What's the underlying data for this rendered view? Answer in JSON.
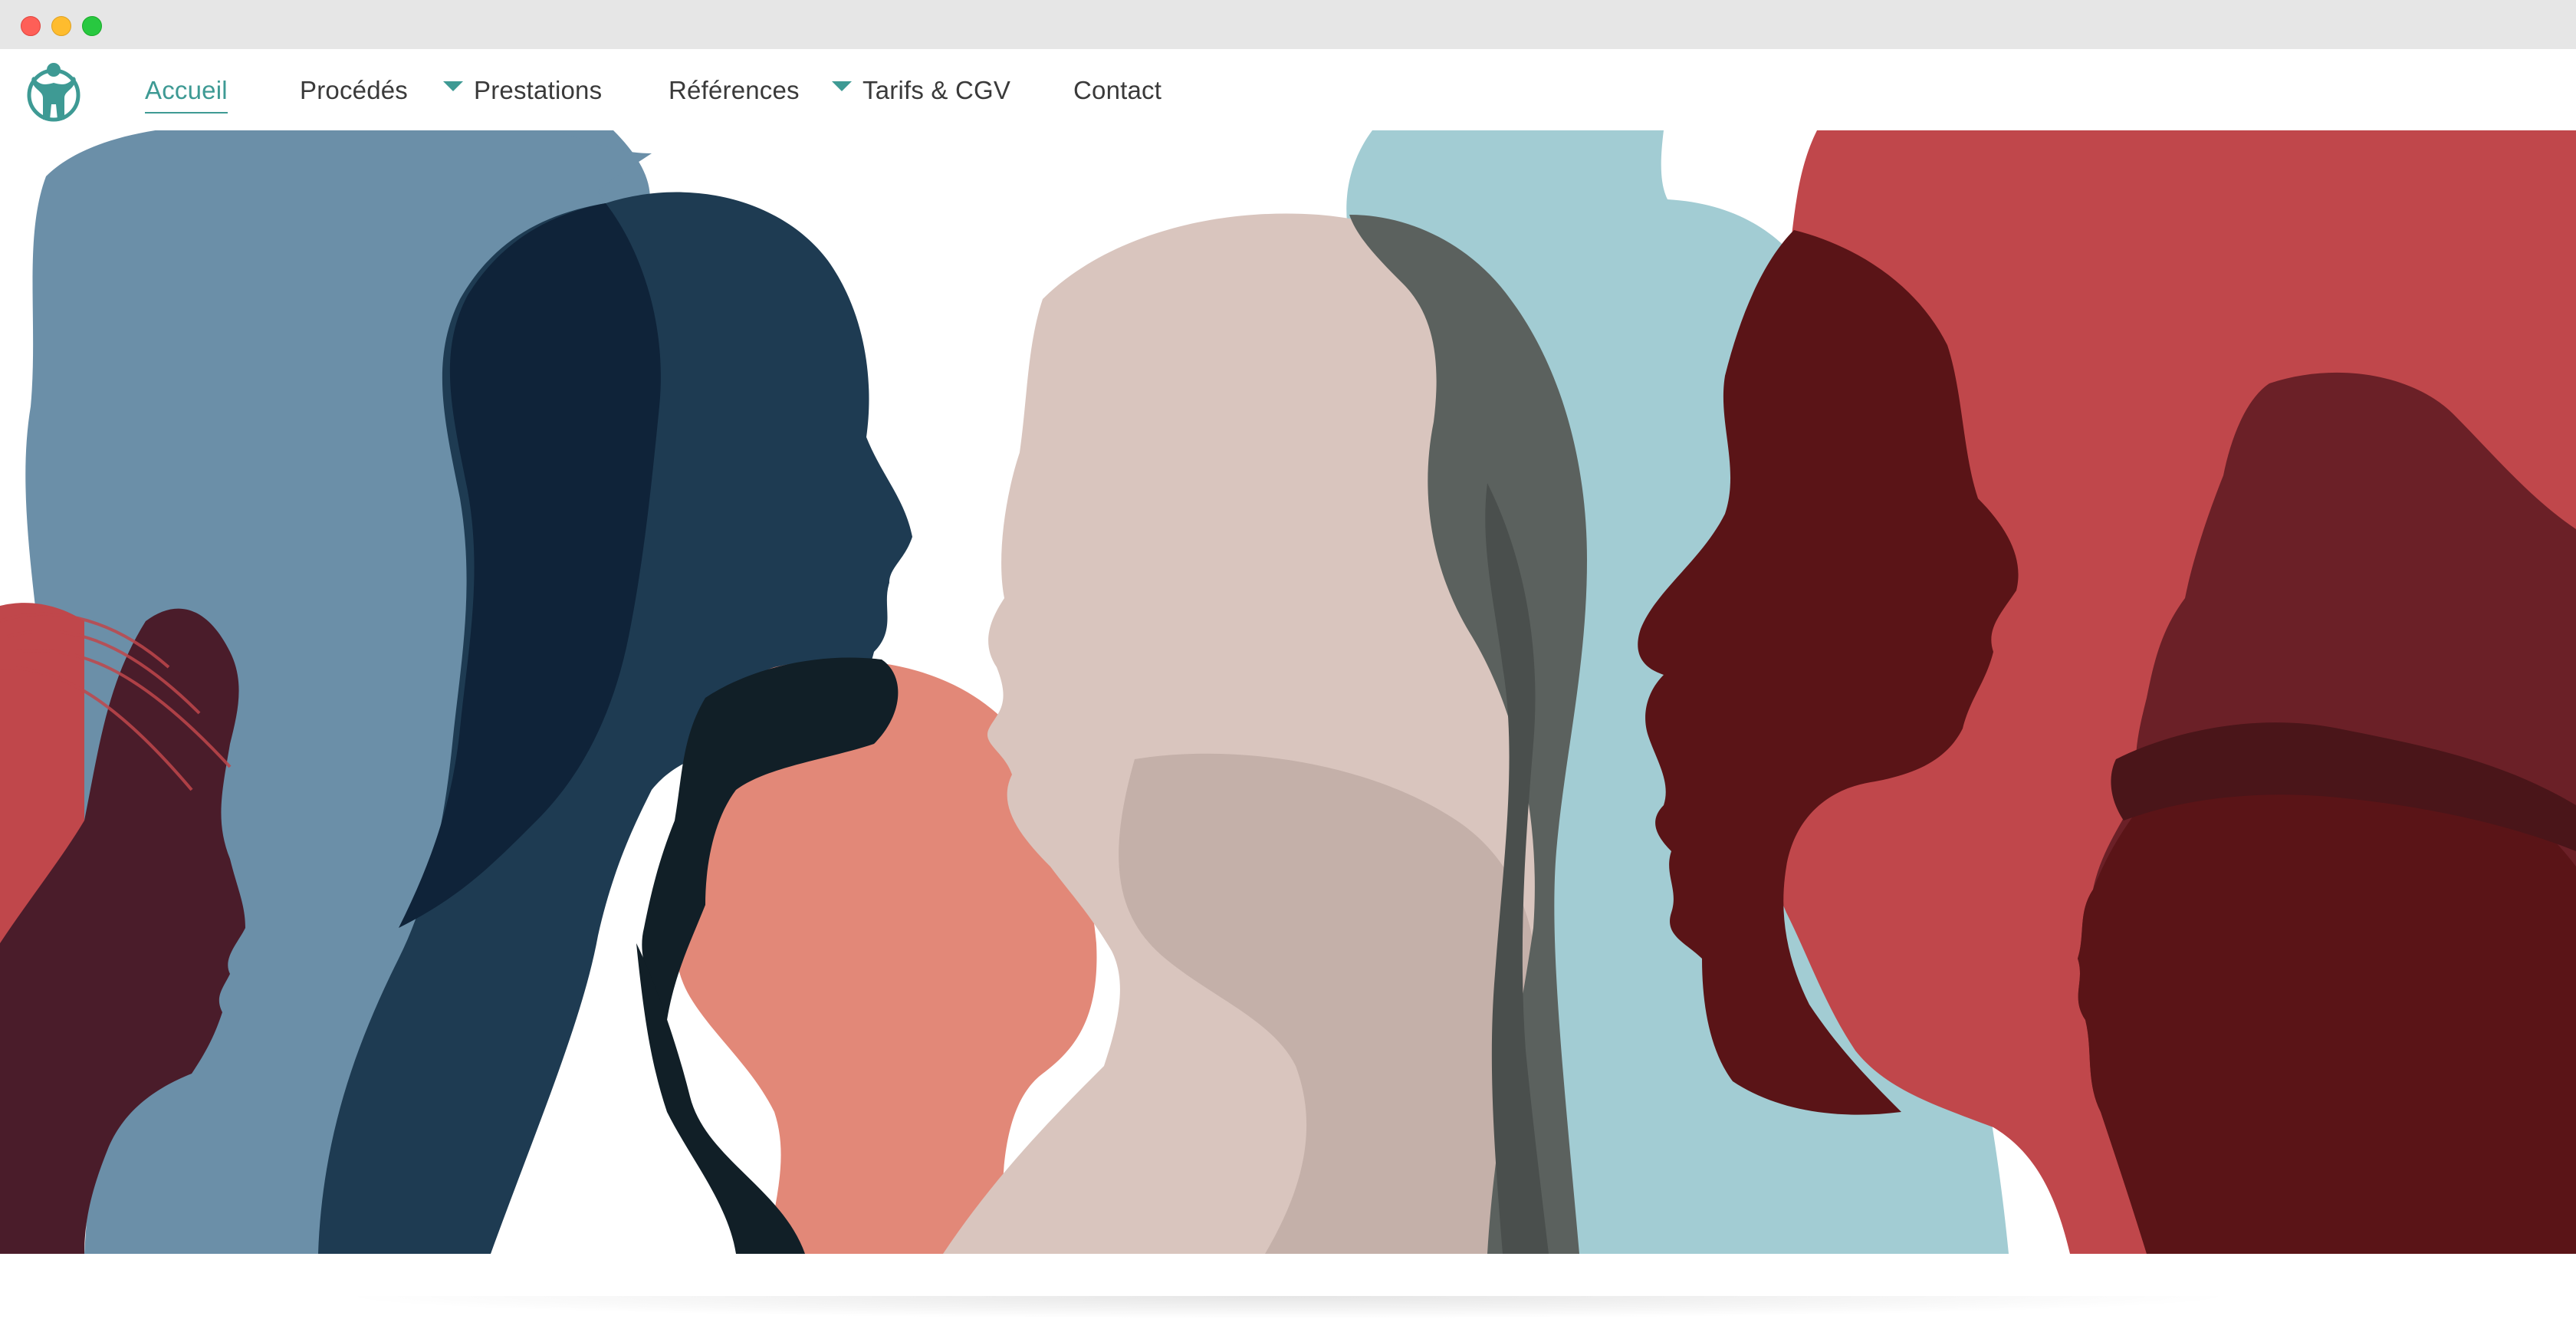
{
  "window": {
    "controls": [
      "close",
      "minimize",
      "zoom"
    ]
  },
  "nav": {
    "logo_icon": "person-arms-raised-icon",
    "items": [
      {
        "label": "Accueil",
        "active": true,
        "has_dropdown": false
      },
      {
        "label": "Procédés",
        "active": false,
        "has_dropdown": false
      },
      {
        "label": "Prestations",
        "active": false,
        "has_dropdown": true
      },
      {
        "label": "Références",
        "active": false,
        "has_dropdown": false
      },
      {
        "label": "Tarifs & CGV",
        "active": false,
        "has_dropdown": true
      },
      {
        "label": "Contact",
        "active": false,
        "has_dropdown": false
      }
    ]
  },
  "hero": {
    "illustration": "diverse-people-profile-silhouettes"
  },
  "colors": {
    "accent": "#3e9a94",
    "nav_text": "#3a3a3a",
    "steel_blue": "#6b8fa8",
    "navy": "#1e3b52",
    "coral": "#e28878",
    "beige": "#d9c5be",
    "light_teal": "#a2ccd3",
    "red": "#c0474b",
    "dark_red": "#5a1417"
  }
}
